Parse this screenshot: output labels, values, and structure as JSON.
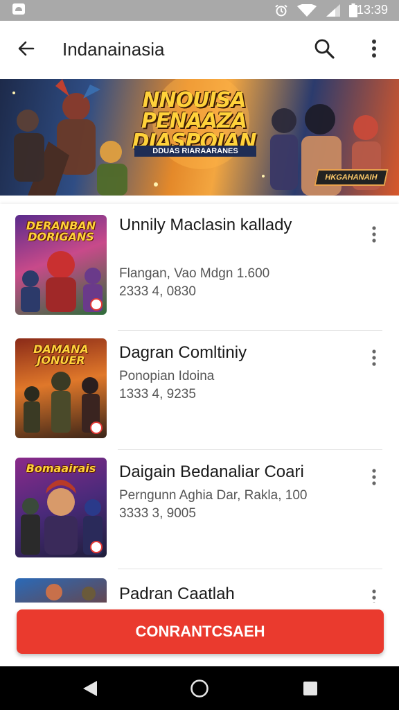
{
  "status_bar": {
    "time": "13:39",
    "icons": [
      "notification-icon",
      "alarm-icon",
      "wifi-icon",
      "signal-icon",
      "battery-icon"
    ]
  },
  "app_bar": {
    "title": "Indanainasia",
    "icons": [
      "back-arrow-icon",
      "search-icon",
      "more-vert-icon"
    ]
  },
  "banner": {
    "title": "NNOUISA PENAAZA DJASPOIAN",
    "subtitle": "DDUAS RIARAARANES",
    "badge": "HKGAHANAIH"
  },
  "list": {
    "items": [
      {
        "thumb_title": "DERANBAN DORIGANS",
        "title": "Unnily Maclasin kallady",
        "meta1": "Flangan, Vao Mdgn 1.600",
        "meta2": "2333 4, 0830"
      },
      {
        "thumb_title": "DAMANA JONUER",
        "title": "Dagran Comltiniy",
        "meta1": "Ponopian Idoina",
        "meta2": "1333 4, 9235"
      },
      {
        "thumb_title": "Bomaairais",
        "title": "Daigain Bedanaliar Coari",
        "meta1": "Perngunn Aghia Dar, Rakla, 100",
        "meta2": "3333 3, 9005"
      },
      {
        "thumb_title": "",
        "title": "Padran Caatlah",
        "meta1": "",
        "meta2": ""
      }
    ]
  },
  "cta": {
    "label": "CONRANTCSAEH"
  },
  "colors": {
    "accent": "#ea3a2e",
    "status_bar": "#a9a9a9",
    "nav_bar": "#000000"
  },
  "nav_bar": {
    "icons": [
      "back-triangle-icon",
      "home-circle-icon",
      "recents-square-icon"
    ]
  }
}
